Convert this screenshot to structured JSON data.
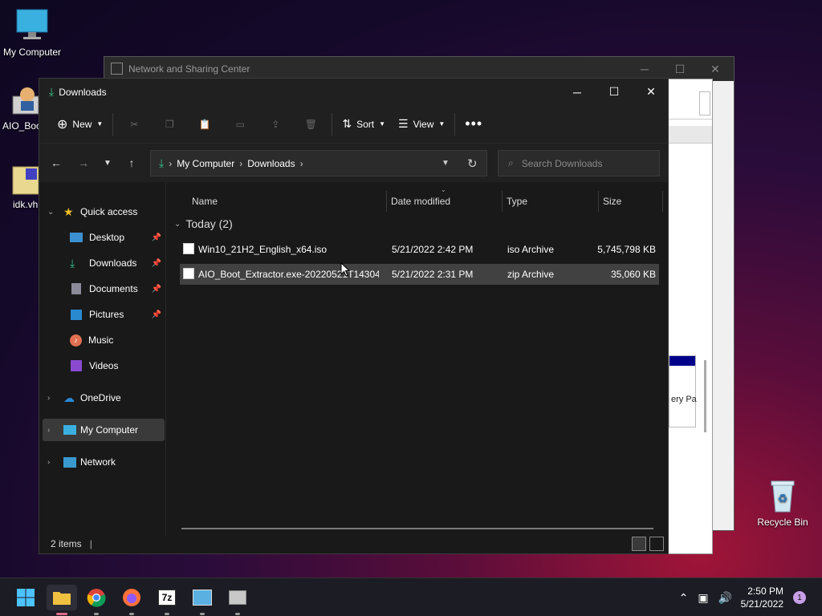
{
  "desktop": {
    "icons": [
      {
        "label": "My Computer"
      },
      {
        "label": "AIO_Boo"
      },
      {
        "label": "idk.vh"
      },
      {
        "label": "Recycle Bin"
      }
    ]
  },
  "background_window": {
    "title": "Network and Sharing Center",
    "partial_text": "ery Pa"
  },
  "explorer": {
    "title": "Downloads",
    "toolbar": {
      "new_label": "New",
      "sort_label": "Sort",
      "view_label": "View"
    },
    "address": {
      "crumbs": [
        "My Computer",
        "Downloads"
      ]
    },
    "search": {
      "placeholder": "Search Downloads"
    },
    "sidebar": {
      "quick_access": "Quick access",
      "items": [
        "Desktop",
        "Downloads",
        "Documents",
        "Pictures",
        "Music",
        "Videos"
      ],
      "onedrive": "OneDrive",
      "my_computer": "My Computer",
      "network": "Network"
    },
    "columns": {
      "name": "Name",
      "date": "Date modified",
      "type": "Type",
      "size": "Size"
    },
    "group": "Today (2)",
    "files": [
      {
        "name": "Win10_21H2_English_x64.iso",
        "date": "5/21/2022 2:42 PM",
        "type": "iso Archive",
        "size": "5,745,798 KB"
      },
      {
        "name": "AIO_Boot_Extractor.exe-20220521T14304...",
        "date": "5/21/2022 2:31 PM",
        "type": "zip Archive",
        "size": "35,060 KB"
      }
    ],
    "status": "2 items"
  },
  "taskbar": {
    "time": "2:50 PM",
    "date": "5/21/2022",
    "notifications": "1"
  }
}
